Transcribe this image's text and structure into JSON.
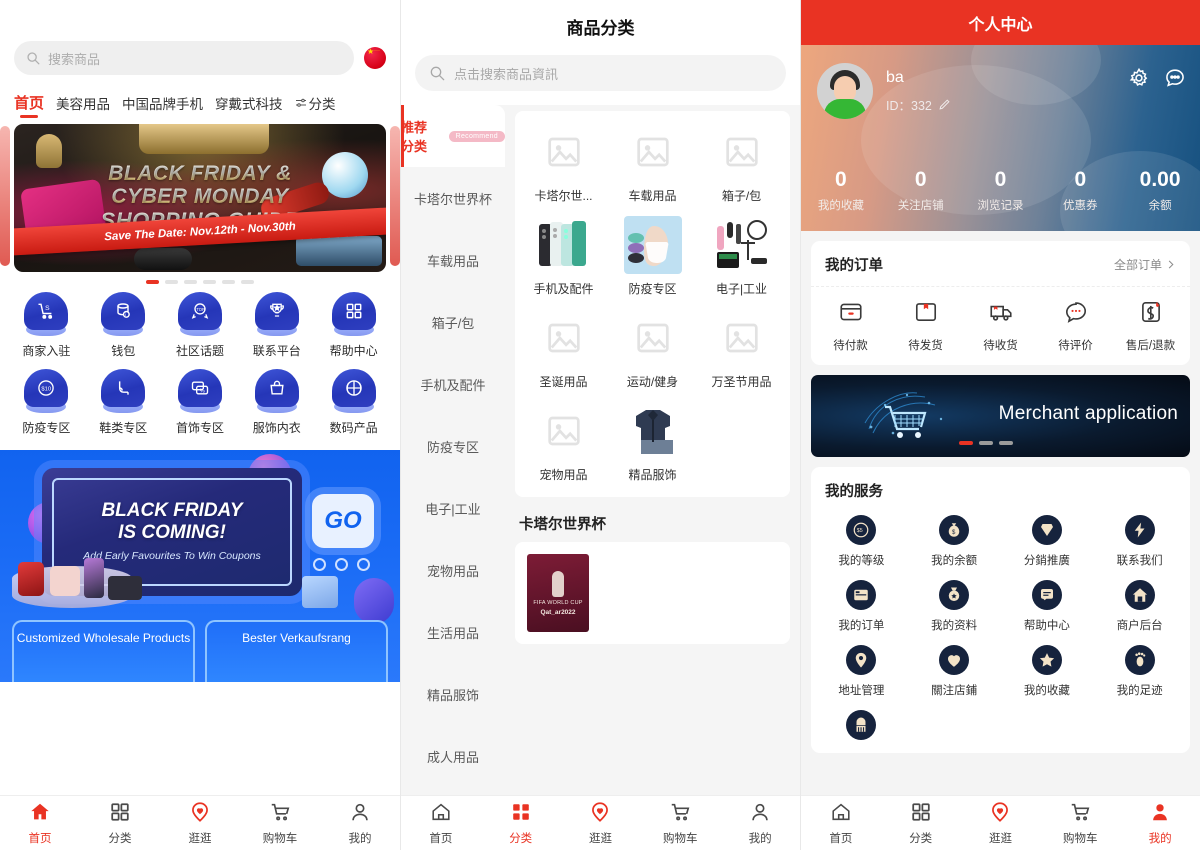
{
  "left": {
    "search": {
      "placeholder": "搜索商品",
      "icon": "search-icon"
    },
    "flag": "china-flag-icon",
    "tabs": [
      {
        "label": "首页",
        "active": true
      },
      {
        "label": "美容用品",
        "active": false
      },
      {
        "label": "中国品牌手机",
        "active": false
      },
      {
        "label": "穿戴式科技",
        "active": false
      },
      {
        "label": "分类",
        "active": false,
        "icon": "filter-icon"
      }
    ],
    "banner": {
      "line1": "BLACK FRIDAY &",
      "line2": "CYBER MONDAY",
      "line3": "SHOPPING GUIDE",
      "ribbon": "Save The Date: Nov.12th - Nov.30th",
      "dots": 6,
      "active_dot": 0
    },
    "icon_grid": [
      {
        "label": "商家入驻",
        "icon": "cart-s-icon"
      },
      {
        "label": "钱包",
        "icon": "wallet-coins-icon"
      },
      {
        "label": "社区话题",
        "icon": "top-medal-icon"
      },
      {
        "label": "联系平台",
        "icon": "trophy-icon"
      },
      {
        "label": "帮助中心",
        "icon": "grid-squares-icon"
      },
      {
        "label": "防疫专区",
        "icon": "ten-badge-icon"
      },
      {
        "label": "鞋类专区",
        "icon": "highheel-icon"
      },
      {
        "label": "首饰专区",
        "icon": "percent-card-icon"
      },
      {
        "label": "服饰内衣",
        "icon": "handbag-icon"
      },
      {
        "label": "数码产品",
        "icon": "basketball-icon"
      }
    ],
    "promo": {
      "title1": "BLACK FRIDAY",
      "title2": "IS COMING!",
      "subtitle": "Add Early Favourites To Win Coupons",
      "go": "GO",
      "card1": "Customized Wholesale Products",
      "card2": "Bester Verkaufsrang"
    },
    "tabbar": [
      {
        "label": "首页",
        "icon": "home-icon",
        "active": true
      },
      {
        "label": "分类",
        "icon": "grid-icon",
        "active": false
      },
      {
        "label": "逛逛",
        "icon": "heart-pin-icon",
        "active": false
      },
      {
        "label": "购物车",
        "icon": "cart-icon",
        "active": false
      },
      {
        "label": "我的",
        "icon": "user-icon",
        "active": false
      }
    ]
  },
  "middle": {
    "title": "商品分类",
    "search": {
      "placeholder": "点击搜索商品資訊",
      "icon": "search-icon"
    },
    "side_items": [
      {
        "label": "推荐分类",
        "badge": "Recommend",
        "active": true
      },
      {
        "label": "卡塔尔世界杯",
        "active": false
      },
      {
        "label": "车载用品",
        "active": false
      },
      {
        "label": "箱子/包",
        "active": false
      },
      {
        "label": "手机及配件",
        "active": false
      },
      {
        "label": "防疫专区",
        "active": false
      },
      {
        "label": "电子|工业",
        "active": false
      },
      {
        "label": "宠物用品",
        "active": false
      },
      {
        "label": "生活用品",
        "active": false
      },
      {
        "label": "精品服饰",
        "active": false
      },
      {
        "label": "成人用品",
        "active": false
      }
    ],
    "grid": [
      {
        "label": "卡塔尔世...",
        "thumb": "placeholder"
      },
      {
        "label": "车载用品",
        "thumb": "placeholder"
      },
      {
        "label": "箱子/包",
        "thumb": "placeholder"
      },
      {
        "label": "手机及配件",
        "thumb": "phones"
      },
      {
        "label": "防疫专区",
        "thumb": "masks"
      },
      {
        "label": "电子|工业",
        "thumb": "electronics"
      },
      {
        "label": "圣诞用品",
        "thumb": "placeholder"
      },
      {
        "label": "运动/健身",
        "thumb": "placeholder"
      },
      {
        "label": "万圣节用品",
        "thumb": "placeholder"
      },
      {
        "label": "宠物用品",
        "thumb": "placeholder"
      },
      {
        "label": "精品服饰",
        "thumb": "shirt"
      }
    ],
    "section_title": "卡塔尔世界杯",
    "wc_item": {
      "t1": "FIFA WORLD CUP",
      "t2": "Qat_ar2022"
    },
    "tabbar": [
      {
        "label": "首页",
        "icon": "home-icon",
        "active": false
      },
      {
        "label": "分类",
        "icon": "grid-icon",
        "active": true
      },
      {
        "label": "逛逛",
        "icon": "heart-pin-icon",
        "active": false
      },
      {
        "label": "购物车",
        "icon": "cart-icon",
        "active": false
      },
      {
        "label": "我的",
        "icon": "user-icon",
        "active": false
      }
    ]
  },
  "right": {
    "title": "个人中心",
    "user": {
      "name": "ba",
      "id_label": "ID：332",
      "edit_icon": "pencil-icon"
    },
    "header_icons": [
      {
        "name": "gear-icon"
      },
      {
        "name": "chat-dots-icon"
      }
    ],
    "stats": [
      {
        "num": "0",
        "cap": "我的收藏"
      },
      {
        "num": "0",
        "cap": "关注店铺"
      },
      {
        "num": "0",
        "cap": "浏览记录"
      },
      {
        "num": "0",
        "cap": "优惠券"
      },
      {
        "num": "0.00",
        "cap": "余额"
      }
    ],
    "orders": {
      "title": "我的订单",
      "more": "全部订单",
      "items": [
        {
          "label": "待付款",
          "icon": "wallet-minus-icon"
        },
        {
          "label": "待发货",
          "icon": "box-icon"
        },
        {
          "label": "待收货",
          "icon": "truck-icon"
        },
        {
          "label": "待评价",
          "icon": "comment-icon"
        },
        {
          "label": "售后/退款",
          "icon": "refund-icon"
        }
      ]
    },
    "merchant_banner": {
      "text": "Merchant application",
      "dots": 3,
      "active_dot": 0
    },
    "services": {
      "title": "我的服务",
      "items": [
        {
          "label": "我的等级",
          "icon": "coin-s5-icon"
        },
        {
          "label": "我的余额",
          "icon": "money-bag-icon"
        },
        {
          "label": "分銷推廣",
          "icon": "diamond-icon"
        },
        {
          "label": "联系我们",
          "icon": "bolt-icon"
        },
        {
          "label": "我的订单",
          "icon": "order-list-icon"
        },
        {
          "label": "我的资料",
          "icon": "medal-star-icon"
        },
        {
          "label": "帮助中心",
          "icon": "help-doc-icon"
        },
        {
          "label": "商户后台",
          "icon": "home-shop-icon"
        },
        {
          "label": "地址管理",
          "icon": "location-pin-icon"
        },
        {
          "label": "關注店鋪",
          "icon": "heart-icon"
        },
        {
          "label": "我的收藏",
          "icon": "star-icon"
        },
        {
          "label": "我的足迹",
          "icon": "footprint-icon"
        },
        {
          "label": "",
          "icon": "broom-icon"
        }
      ]
    },
    "tabbar": [
      {
        "label": "首页",
        "icon": "home-icon",
        "active": false
      },
      {
        "label": "分类",
        "icon": "grid-icon",
        "active": false
      },
      {
        "label": "逛逛",
        "icon": "heart-pin-icon",
        "active": false
      },
      {
        "label": "购物车",
        "icon": "cart-icon",
        "active": false
      },
      {
        "label": "我的",
        "icon": "user-icon",
        "active": true
      }
    ]
  },
  "colors": {
    "accent": "#e93323",
    "nav_blue": "#2536b8",
    "dark_navy": "#16233d"
  }
}
